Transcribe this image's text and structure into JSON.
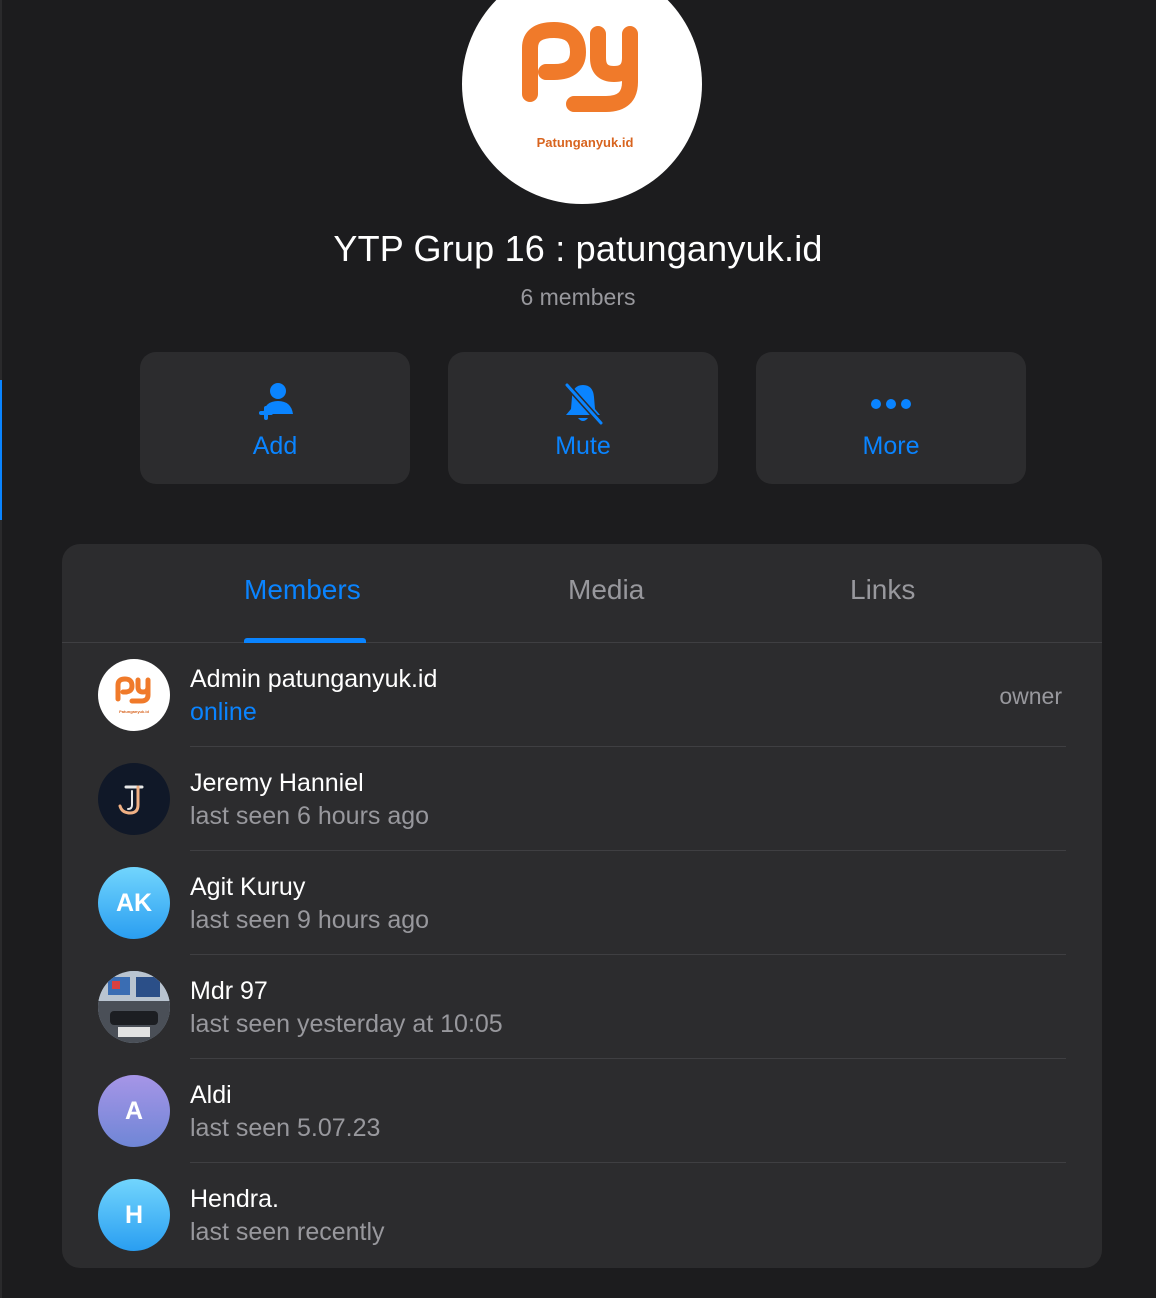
{
  "group": {
    "title": "YTP Grup 16 : patunganyuk.id",
    "subtitle": "6 members",
    "logo_text": "Patunganyuk.id",
    "logo_color": "#f07a2a"
  },
  "actions": [
    {
      "label": "Add",
      "icon": "add-user-icon"
    },
    {
      "label": "Mute",
      "icon": "bell-slash-icon"
    },
    {
      "label": "More",
      "icon": "more-dots-icon"
    }
  ],
  "tabs": [
    {
      "label": "Members",
      "active": true
    },
    {
      "label": "Media",
      "active": false
    },
    {
      "label": "Links",
      "active": false
    }
  ],
  "members": [
    {
      "name": "Admin patunganyuk.id",
      "status": "online",
      "role": "owner",
      "avatar": "logo"
    },
    {
      "name": "Jeremy Hanniel",
      "status": "last seen 6 hours ago",
      "avatar": "J-logo"
    },
    {
      "name": "Agit Kuruy",
      "status": "last seen 9 hours ago",
      "avatar_initials": "AK"
    },
    {
      "name": "Mdr 97",
      "status": "last seen yesterday at 10:05",
      "avatar": "photo"
    },
    {
      "name": "Aldi",
      "status": "last seen 5.07.23",
      "avatar_initials": "A"
    },
    {
      "name": "Hendra.",
      "status": "last seen recently",
      "avatar_initials": "H"
    }
  ],
  "colors": {
    "accent": "#0a84ff",
    "background": "#1c1c1e",
    "panel": "#2c2c2e",
    "secondary_text": "#98989d"
  }
}
